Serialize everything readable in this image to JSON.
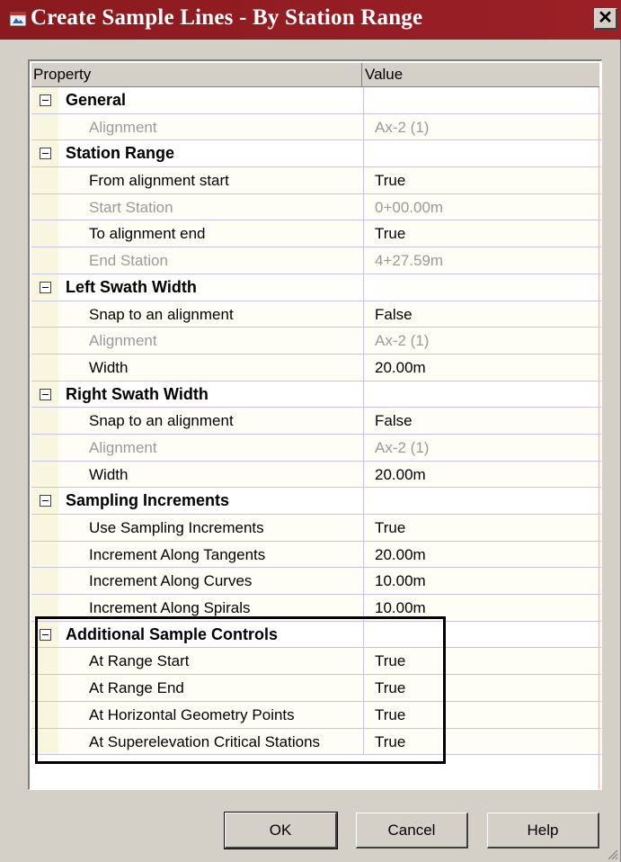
{
  "window": {
    "title": "Create Sample Lines - By Station Range",
    "close_label": "✕",
    "icon": "autocad-app-icon"
  },
  "grid": {
    "headers": {
      "property": "Property",
      "value": "Value"
    },
    "rows": [
      {
        "type": "category",
        "label": "General"
      },
      {
        "type": "prop",
        "label": "Alignment",
        "value": "Ax-2 (1)",
        "disabled": true
      },
      {
        "type": "category",
        "label": "Station Range"
      },
      {
        "type": "prop",
        "label": "From alignment start",
        "value": "True",
        "disabled": false
      },
      {
        "type": "prop",
        "label": "Start Station",
        "value": "0+00.00m",
        "disabled": true
      },
      {
        "type": "prop",
        "label": "To alignment end",
        "value": "True",
        "disabled": false
      },
      {
        "type": "prop",
        "label": "End Station",
        "value": "4+27.59m",
        "disabled": true
      },
      {
        "type": "category",
        "label": "Left Swath Width"
      },
      {
        "type": "prop",
        "label": "Snap to an alignment",
        "value": "False",
        "disabled": false
      },
      {
        "type": "prop",
        "label": "Alignment",
        "value": "Ax-2 (1)",
        "disabled": true
      },
      {
        "type": "prop",
        "label": "Width",
        "value": "20.00m",
        "disabled": false
      },
      {
        "type": "category",
        "label": "Right Swath Width"
      },
      {
        "type": "prop",
        "label": "Snap to an alignment",
        "value": "False",
        "disabled": false
      },
      {
        "type": "prop",
        "label": "Alignment",
        "value": "Ax-2 (1)",
        "disabled": true
      },
      {
        "type": "prop",
        "label": "Width",
        "value": "20.00m",
        "disabled": false
      },
      {
        "type": "category",
        "label": "Sampling Increments"
      },
      {
        "type": "prop",
        "label": "Use Sampling Increments",
        "value": "True",
        "disabled": false
      },
      {
        "type": "prop",
        "label": "Increment Along Tangents",
        "value": "20.00m",
        "disabled": false
      },
      {
        "type": "prop",
        "label": "Increment Along Curves",
        "value": "10.00m",
        "disabled": false
      },
      {
        "type": "prop",
        "label": "Increment Along Spirals",
        "value": "10.00m",
        "disabled": false
      },
      {
        "type": "category",
        "label": "Additional Sample Controls"
      },
      {
        "type": "prop",
        "label": "At Range Start",
        "value": "True",
        "disabled": false
      },
      {
        "type": "prop",
        "label": "At Range End",
        "value": "True",
        "disabled": false
      },
      {
        "type": "prop",
        "label": "At Horizontal Geometry Points",
        "value": "True",
        "disabled": false
      },
      {
        "type": "prop",
        "label": "At Superelevation Critical Stations",
        "value": "True",
        "disabled": false
      }
    ]
  },
  "buttons": {
    "ok": "OK",
    "cancel": "Cancel",
    "help": "Help"
  },
  "colors": {
    "titlebar": "#9b2026",
    "row_tint": "#fffef6",
    "grid_line": "#c6c4ea"
  }
}
